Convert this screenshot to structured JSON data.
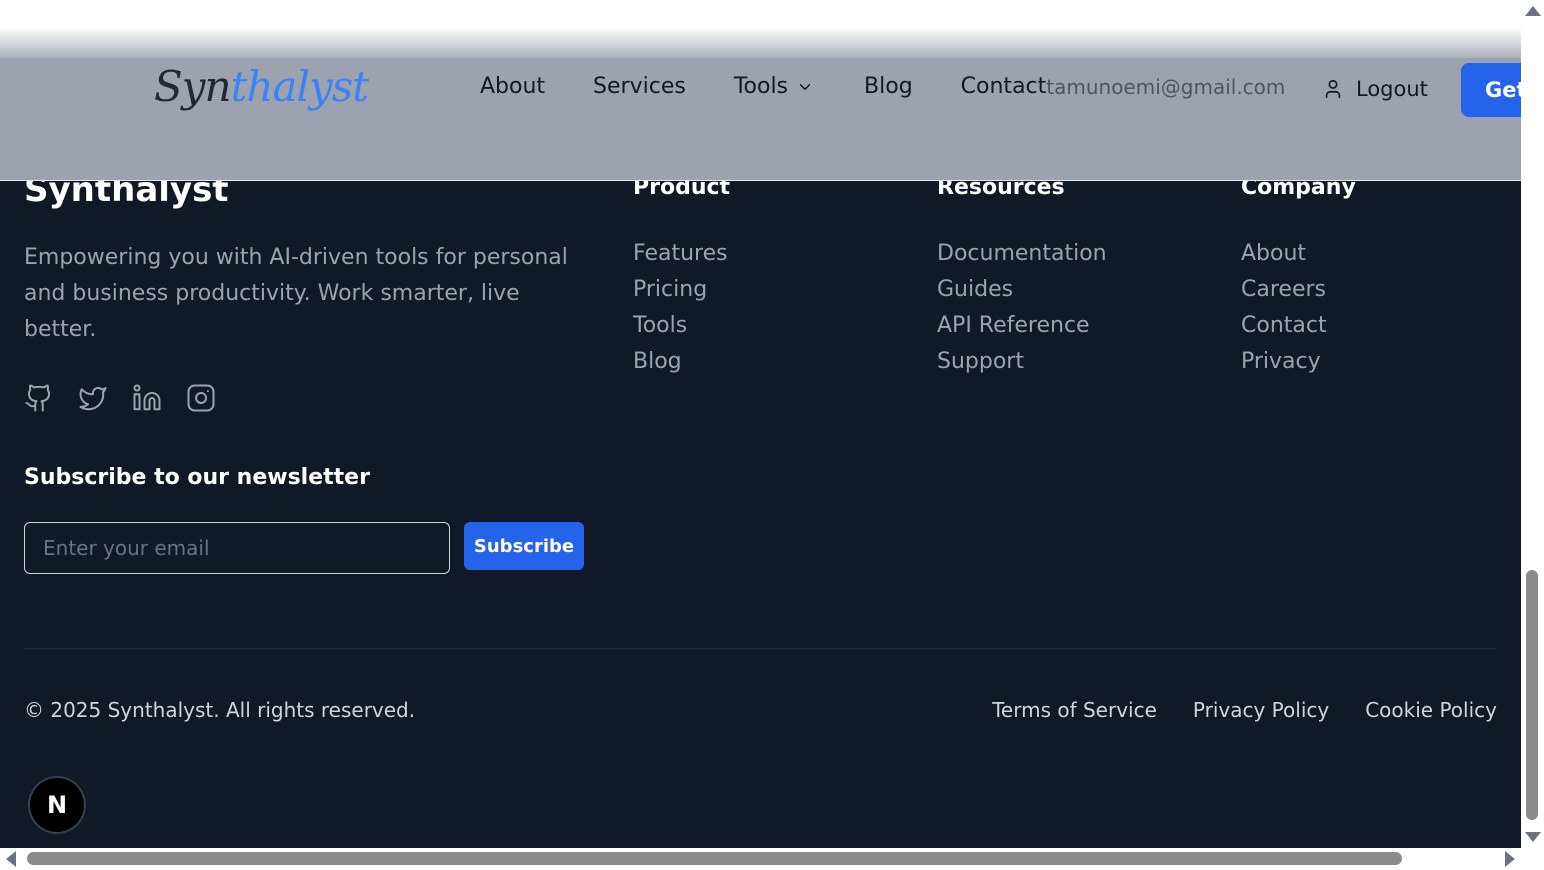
{
  "header": {
    "logo": {
      "part1": "Syn",
      "part2": "thalyst"
    },
    "nav": {
      "about": "About",
      "services": "Services",
      "tools": "Tools",
      "blog": "Blog",
      "contact": "Contact"
    },
    "user_email": "tamunoemi@gmail.com",
    "logout_label": "Logout",
    "cta_label": "Get"
  },
  "footer": {
    "brand": "Synthalyst",
    "description": "Empowering you with AI-driven tools for personal and business productivity. Work smarter, live better.",
    "socials": [
      "github-icon",
      "twitter-icon",
      "linkedin-icon",
      "instagram-icon"
    ],
    "newsletter": {
      "title": "Subscribe to our newsletter",
      "placeholder": "Enter your email",
      "button": "Subscribe"
    },
    "columns": [
      {
        "title": "Product",
        "links": [
          "Features",
          "Pricing",
          "Tools",
          "Blog"
        ]
      },
      {
        "title": "Resources",
        "links": [
          "Documentation",
          "Guides",
          "API Reference",
          "Support"
        ]
      },
      {
        "title": "Company",
        "links": [
          "About",
          "Careers",
          "Contact",
          "Privacy"
        ]
      }
    ],
    "copyright": "© 2025 Synthalyst. All rights reserved.",
    "legal": {
      "terms": "Terms of Service",
      "privacy": "Privacy Policy",
      "cookie": "Cookie Policy"
    }
  },
  "dev_badge": "N",
  "colors": {
    "footer_bg": "#111827",
    "header_bg": "#9ca3af",
    "accent": "#2563eb",
    "muted_text": "#9ca3af"
  }
}
